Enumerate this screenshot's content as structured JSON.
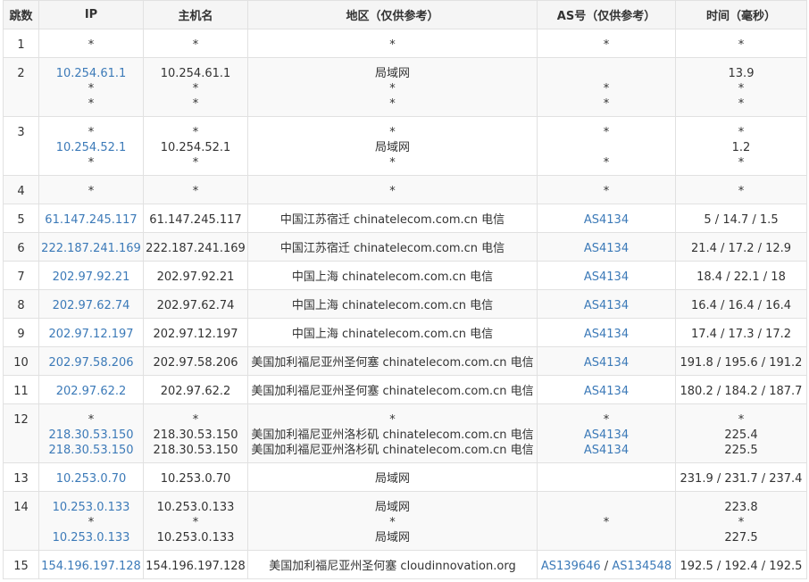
{
  "headers": [
    "跳数",
    "IP",
    "主机名",
    "地区（仅供参考）",
    "AS号（仅供参考）",
    "时间（毫秒）"
  ],
  "rows": [
    {
      "hop": "1",
      "h": 32,
      "ip": [
        "*"
      ],
      "host": [
        "*"
      ],
      "region": [
        "*"
      ],
      "as": [
        [
          "*"
        ]
      ],
      "time": [
        "*"
      ]
    },
    {
      "hop": "2",
      "h": 66,
      "ip": [
        "10.254.61.1",
        "*",
        "*"
      ],
      "host": [
        "10.254.61.1",
        "*",
        "*"
      ],
      "region": [
        "局域网",
        "*",
        "*"
      ],
      "as": [
        [
          ""
        ],
        [
          "*"
        ],
        [
          "*"
        ]
      ],
      "time": [
        "13.9",
        "*",
        "*"
      ]
    },
    {
      "hop": "3",
      "h": 66,
      "ip": [
        "*",
        "10.254.52.1",
        "*"
      ],
      "host": [
        "*",
        "10.254.52.1",
        "*"
      ],
      "region": [
        "*",
        "局域网",
        "*"
      ],
      "as": [
        [
          "*"
        ],
        [
          ""
        ],
        [
          "*"
        ]
      ],
      "time": [
        "*",
        "1.2",
        "*"
      ]
    },
    {
      "hop": "4",
      "h": 32,
      "ip": [
        "*"
      ],
      "host": [
        "*"
      ],
      "region": [
        "*"
      ],
      "as": [
        [
          "*"
        ]
      ],
      "time": [
        "*"
      ]
    },
    {
      "hop": "5",
      "h": 32,
      "ip": [
        "61.147.245.117"
      ],
      "host": [
        "61.147.245.117"
      ],
      "region": [
        "中国江苏宿迁 chinatelecom.com.cn 电信"
      ],
      "as": [
        [
          "AS4134"
        ]
      ],
      "time": [
        "5 / 14.7 / 1.5"
      ]
    },
    {
      "hop": "6",
      "h": 32,
      "ip": [
        "222.187.241.169"
      ],
      "host": [
        "222.187.241.169"
      ],
      "region": [
        "中国江苏宿迁 chinatelecom.com.cn 电信"
      ],
      "as": [
        [
          "AS4134"
        ]
      ],
      "time": [
        "21.4 / 17.2 / 12.9"
      ]
    },
    {
      "hop": "7",
      "h": 32,
      "ip": [
        "202.97.92.21"
      ],
      "host": [
        "202.97.92.21"
      ],
      "region": [
        "中国上海 chinatelecom.com.cn 电信"
      ],
      "as": [
        [
          "AS4134"
        ]
      ],
      "time": [
        "18.4 / 22.1 / 18"
      ]
    },
    {
      "hop": "8",
      "h": 32,
      "ip": [
        "202.97.62.74"
      ],
      "host": [
        "202.97.62.74"
      ],
      "region": [
        "中国上海 chinatelecom.com.cn 电信"
      ],
      "as": [
        [
          "AS4134"
        ]
      ],
      "time": [
        "16.4 / 16.4 / 16.4"
      ]
    },
    {
      "hop": "9",
      "h": 32,
      "ip": [
        "202.97.12.197"
      ],
      "host": [
        "202.97.12.197"
      ],
      "region": [
        "中国上海 chinatelecom.com.cn 电信"
      ],
      "as": [
        [
          "AS4134"
        ]
      ],
      "time": [
        "17.4 / 17.3 / 17.2"
      ]
    },
    {
      "hop": "10",
      "h": 32,
      "ip": [
        "202.97.58.206"
      ],
      "host": [
        "202.97.58.206"
      ],
      "region": [
        "美国加利福尼亚州圣何塞 chinatelecom.com.cn 电信"
      ],
      "as": [
        [
          "AS4134"
        ]
      ],
      "time": [
        "191.8 / 195.6 / 191.2"
      ]
    },
    {
      "hop": "11",
      "h": 32,
      "ip": [
        "202.97.62.2"
      ],
      "host": [
        "202.97.62.2"
      ],
      "region": [
        "美国加利福尼亚州圣何塞 chinatelecom.com.cn 电信"
      ],
      "as": [
        [
          "AS4134"
        ]
      ],
      "time": [
        "180.2 / 184.2 / 187.7"
      ]
    },
    {
      "hop": "12",
      "h": 66,
      "ip": [
        "*",
        "218.30.53.150",
        "218.30.53.150"
      ],
      "host": [
        "*",
        "218.30.53.150",
        "218.30.53.150"
      ],
      "region": [
        "*",
        "美国加利福尼亚州洛杉矶 chinatelecom.com.cn 电信",
        "美国加利福尼亚州洛杉矶 chinatelecom.com.cn 电信"
      ],
      "as": [
        [
          "*"
        ],
        [
          "AS4134"
        ],
        [
          "AS4134"
        ]
      ],
      "time": [
        "*",
        "225.4",
        "225.5"
      ]
    },
    {
      "hop": "13",
      "h": 32,
      "ip": [
        "10.253.0.70"
      ],
      "host": [
        "10.253.0.70"
      ],
      "region": [
        "局域网"
      ],
      "as": [
        [
          ""
        ]
      ],
      "time": [
        "231.9 / 231.7 / 237.4"
      ]
    },
    {
      "hop": "14",
      "h": 66,
      "ip": [
        "10.253.0.133",
        "*",
        "10.253.0.133"
      ],
      "host": [
        "10.253.0.133",
        "*",
        "10.253.0.133"
      ],
      "region": [
        "局域网",
        "*",
        "局域网"
      ],
      "as": [
        [
          ""
        ],
        [
          "*"
        ],
        [
          ""
        ]
      ],
      "time": [
        "223.8",
        "*",
        "227.5"
      ]
    },
    {
      "hop": "15",
      "h": 32,
      "ip": [
        "154.196.197.128"
      ],
      "host": [
        "154.196.197.128"
      ],
      "region": [
        "美国加利福尼亚州圣何塞 cloudinnovation.org"
      ],
      "as": [
        [
          "AS139646",
          "AS134548"
        ]
      ],
      "time": [
        "192.5 / 192.4 / 192.5"
      ]
    }
  ],
  "as_separator": " / "
}
